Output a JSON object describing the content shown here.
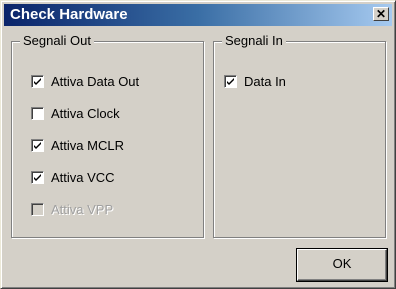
{
  "window": {
    "title": "Check Hardware",
    "close_glyph": "✕"
  },
  "groups": {
    "out": {
      "legend": "Segnali Out",
      "items": [
        {
          "label": "Attiva Data Out",
          "checked": true,
          "enabled": true
        },
        {
          "label": "Attiva Clock",
          "checked": false,
          "enabled": true
        },
        {
          "label": "Attiva MCLR",
          "checked": true,
          "enabled": true
        },
        {
          "label": "Attiva VCC",
          "checked": true,
          "enabled": true
        },
        {
          "label": "Attiva VPP",
          "checked": false,
          "enabled": false
        }
      ]
    },
    "in": {
      "legend": "Segnali In",
      "items": [
        {
          "label": "Data In",
          "checked": true,
          "enabled": true
        }
      ]
    }
  },
  "buttons": {
    "ok": "OK"
  },
  "colors": {
    "title_start": "#0a246a",
    "title_end": "#a6caf0",
    "face": "#d4d0c8"
  }
}
